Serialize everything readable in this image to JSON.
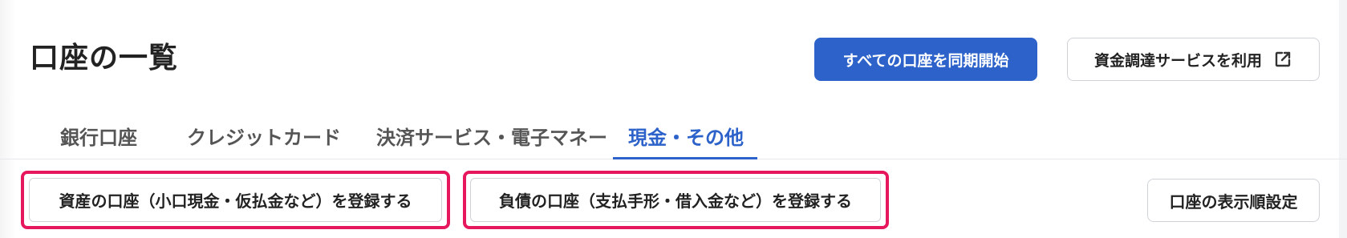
{
  "header": {
    "title": "口座の一覧",
    "sync_all_label": "すべての口座を同期開始",
    "funding_label": "資金調達サービスを利用",
    "funding_icon": "external-link-icon"
  },
  "tabs": [
    {
      "label": "銀行口座",
      "active": false
    },
    {
      "label": "クレジットカード",
      "active": false
    },
    {
      "label": "決済サービス・電子マネー",
      "active": false
    },
    {
      "label": "現金・その他",
      "active": true
    }
  ],
  "actions": {
    "register_assets_label": "資産の口座（小口現金・仮払金など）を登録する",
    "register_liabilities_label": "負債の口座（支払手形・借入金など）を登録する",
    "display_order_label": "口座の表示順設定"
  },
  "colors": {
    "primary": "#2c62c9",
    "highlight": "#e6175c"
  }
}
